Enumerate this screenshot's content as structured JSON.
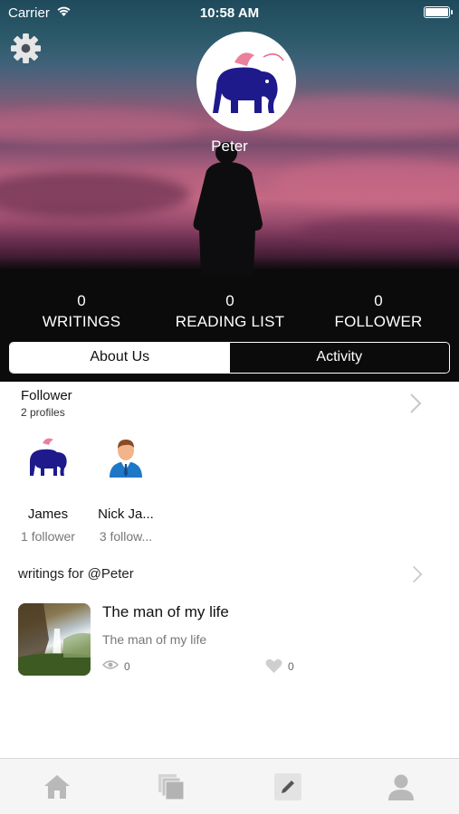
{
  "status_bar": {
    "carrier": "Carrier",
    "time": "10:58 AM"
  },
  "profile": {
    "name": "Peter"
  },
  "stats": [
    {
      "value": "0",
      "label": "WRITINGS"
    },
    {
      "value": "0",
      "label": "READING LIST"
    },
    {
      "value": "0",
      "label": "FOLLOWER"
    }
  ],
  "segments": {
    "selected": "About Us",
    "items": [
      "About Us",
      "Activity"
    ]
  },
  "follower_section": {
    "title": "Follower",
    "subtitle": "2 profiles",
    "profiles": [
      {
        "name": "James",
        "followers": "1 follower",
        "avatar_icon": "elephant-icon"
      },
      {
        "name": "Nick Ja...",
        "followers": "3 follow...",
        "avatar_icon": "businessman-icon"
      }
    ]
  },
  "writings_section": {
    "title": "writings for @Peter",
    "items": [
      {
        "title": "The man of my life",
        "subtitle": "The man of my life",
        "views": "0",
        "likes": "0"
      }
    ]
  },
  "tab_bar": {
    "items": [
      "home-icon",
      "library-icon",
      "write-icon",
      "profile-icon"
    ]
  },
  "colors": {
    "accent_navy": "#1f1a8c",
    "brand_pink": "#e86a8a",
    "inactive_icon": "#b9b9b9"
  }
}
